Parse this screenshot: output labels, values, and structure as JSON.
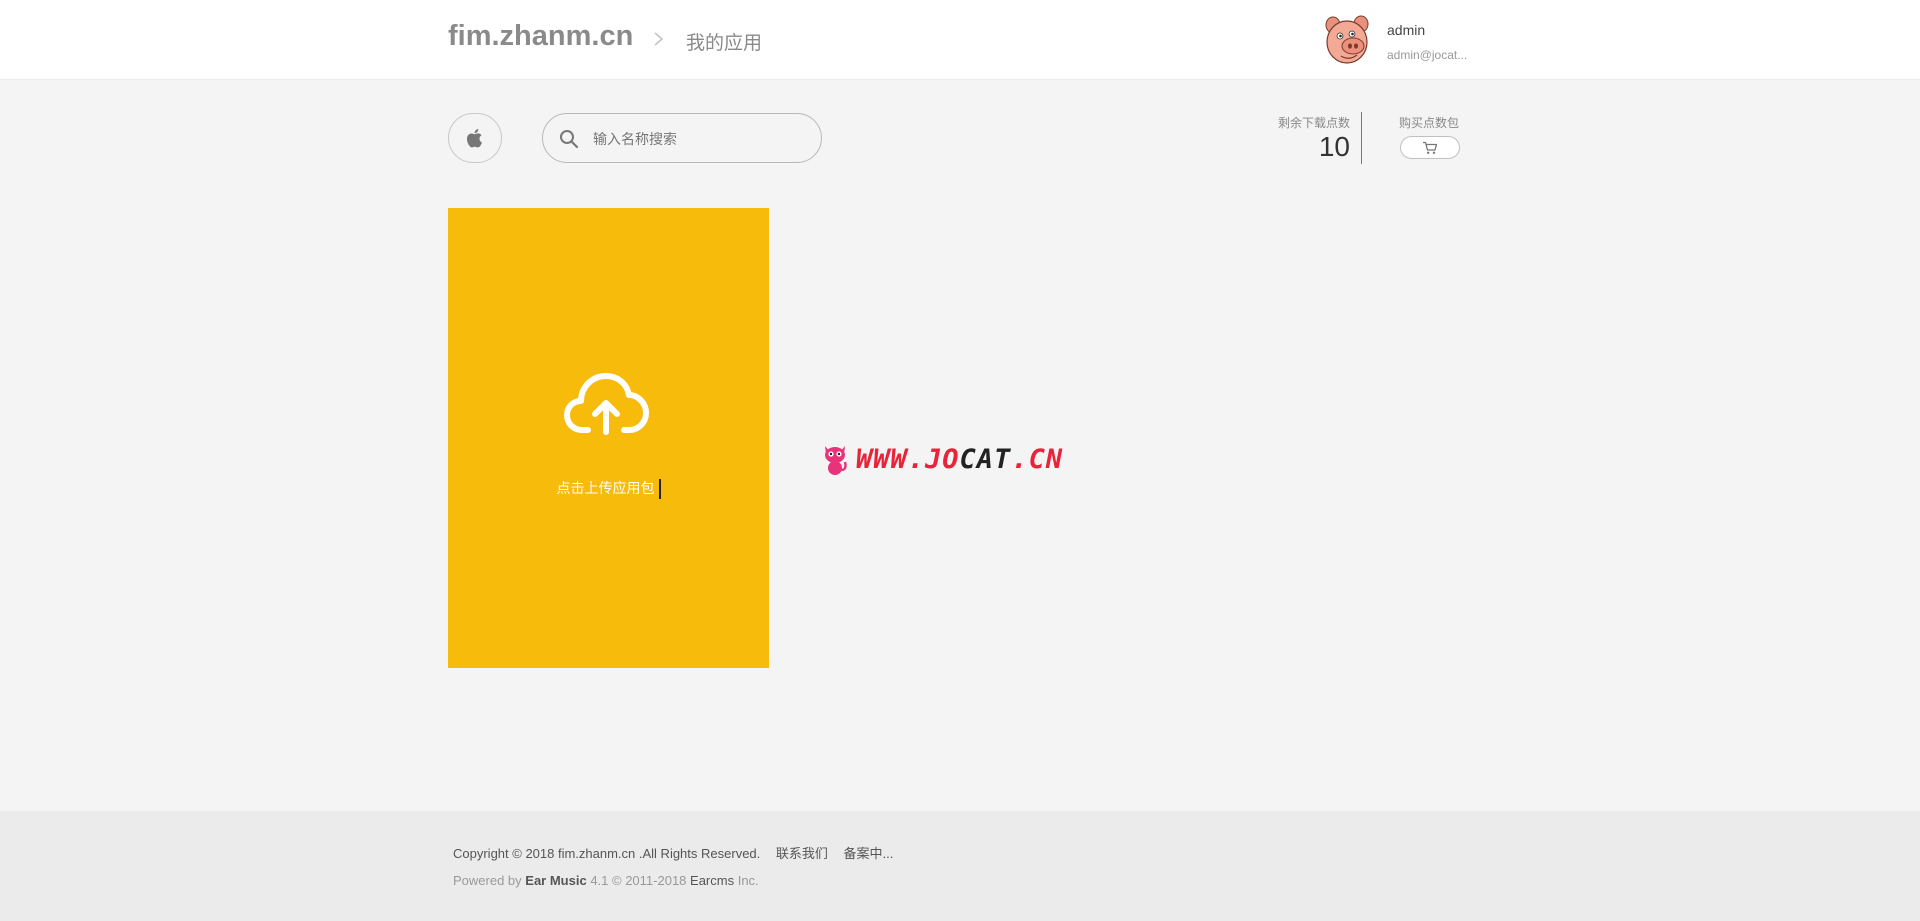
{
  "header": {
    "brand": "fim.zhanm.cn",
    "breadcrumb": "我的应用",
    "user": {
      "name": "admin",
      "email": "admin@jocat..."
    }
  },
  "toolbar": {
    "platform_icon": "apple-icon",
    "search_placeholder": "输入名称搜索",
    "points_label": "剩余下载点数",
    "points_value": "10",
    "buy_label": "购买点数包",
    "buy_icon": "cart-icon"
  },
  "upload": {
    "label": "点击上传应用包",
    "color": "#f7bb0b",
    "icon": "cloud-upload-icon"
  },
  "watermark": {
    "part1": "WWW.JO",
    "part2": "CAT",
    "part3": ".CN"
  },
  "footer": {
    "copyright": "Copyright © 2018 fim.zhanm.cn .All Rights Reserved.",
    "contact": "联系我们",
    "icp": "备案中...",
    "powered_prefix": "Powered by",
    "product": "Ear Music",
    "version_text": "4.1 © 2011-2018",
    "company": "Earcms",
    "company_suffix": "Inc."
  }
}
